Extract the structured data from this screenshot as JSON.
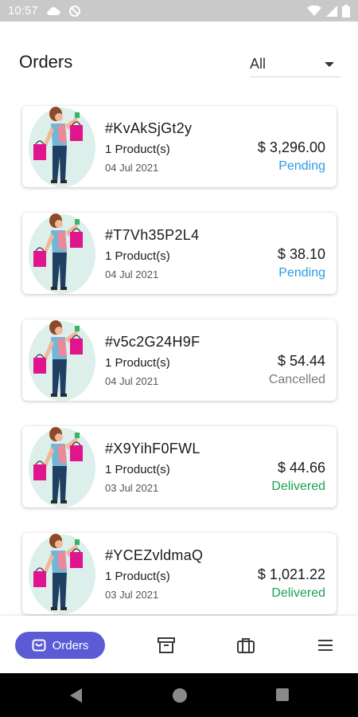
{
  "status_bar": {
    "time": "10:57"
  },
  "header": {
    "title": "Orders",
    "filter_value": "All"
  },
  "orders": [
    {
      "id": "#KvAkSjGt2y",
      "products": "1 Product(s)",
      "date": "04 Jul 2021",
      "price": "$ 3,296.00",
      "status": "Pending"
    },
    {
      "id": "#T7Vh35P2L4",
      "products": "1 Product(s)",
      "date": "04 Jul 2021",
      "price": "$ 38.10",
      "status": "Pending"
    },
    {
      "id": "#v5c2G24H9F",
      "products": "1 Product(s)",
      "date": "04 Jul 2021",
      "price": "$ 54.44",
      "status": "Cancelled"
    },
    {
      "id": "#X9YihF0FWL",
      "products": "1 Product(s)",
      "date": "03 Jul 2021",
      "price": "$ 44.66",
      "status": "Delivered"
    },
    {
      "id": "#YCEZvldmaQ",
      "products": "1 Product(s)",
      "date": "03 Jul 2021",
      "price": "$ 1,021.22",
      "status": "Delivered"
    }
  ],
  "status_colors": {
    "Pending": "#2b9be0",
    "Cancelled": "#7a7a7a",
    "Delivered": "#1aa155"
  },
  "bottom_nav": {
    "active_label": "Orders",
    "accent": "#5b5bd6",
    "icons": [
      "orders-bag-icon",
      "archive-box-icon",
      "briefcase-icon",
      "menu-icon"
    ]
  },
  "colors": {
    "status_bar": "#c9c9c9",
    "system_nav": "#000000"
  }
}
